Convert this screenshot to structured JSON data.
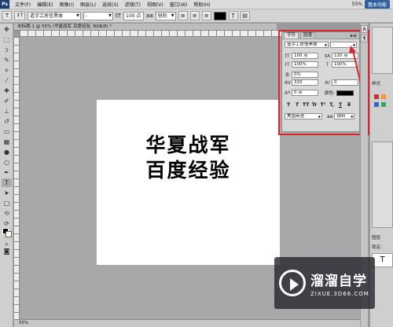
{
  "menubar": {
    "logo": "Ps",
    "items": [
      "文件(F)",
      "编辑(E)",
      "图像(I)",
      "图层(L)",
      "选择(S)",
      "滤镜(T)",
      "视图(V)",
      "窗口(W)",
      "帮助(H)"
    ],
    "zoom": "55%",
    "workspace_button": "基本功能"
  },
  "options": {
    "tool_glyph": "T",
    "orient_glyph": "↕T",
    "font_family": "造字工房信黑体",
    "font_style": "-",
    "size_icon": "ṫT",
    "font_size": "100 点",
    "aa_icon": "aa",
    "aa_mode": "锐利",
    "color": "#000000"
  },
  "document": {
    "tab_title": "未标题-1 @ 55% (华夏战军 百度经验, RGB/8) *",
    "line1": "华夏战军",
    "line2": "百度经验",
    "status": "55%"
  },
  "char_panel": {
    "tab_char": "字符",
    "tab_para": "段落",
    "font_family": "造字工房信黑体",
    "font_style": "-",
    "size_value": "100 点",
    "leading_value": "120 点",
    "tracking_left": "100%",
    "tracking_right": "100%",
    "kerning_value": "0%",
    "vscale_value": "320",
    "hscale_value": "0",
    "baseline_value": "0 点",
    "color_label": "颜色:",
    "style_buttons": [
      "T",
      "T",
      "TT",
      "Tr",
      "T¹",
      "T,",
      "T",
      "T"
    ],
    "language": "美国英语",
    "aa_label": "aa",
    "aa_mode": "锐利"
  },
  "right_panel": {
    "swatch_label": "样式",
    "layer_label": "图层",
    "lock_label": "锁定:"
  },
  "watermark": {
    "title": "溜溜自学",
    "url": "ZIXUE.3D66.COM"
  },
  "colors": {
    "highlight": "#d8262c",
    "accent": "#2f5f9e"
  }
}
